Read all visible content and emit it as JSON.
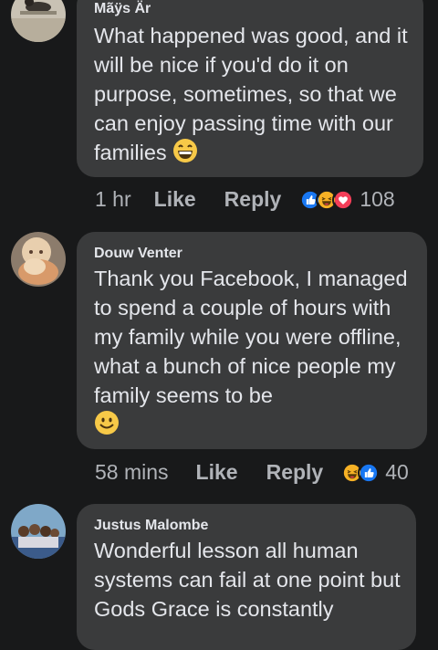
{
  "comments": [
    {
      "author": "Mãÿs Är",
      "text": "What happened was good, and it will be nice if you'd do it on purpose, sometimes, so that we can enjoy passing time with our families",
      "trailing_emoji": "grinning-face-emoji",
      "time": "1 hr",
      "like_label": "Like",
      "reply_label": "Reply",
      "reactions": [
        "like-reaction-icon",
        "haha-reaction-icon",
        "love-reaction-icon"
      ],
      "reaction_count": "108"
    },
    {
      "author": "Douw Venter",
      "text": "Thank you Facebook, I managed to spend a couple of hours with my family while you were offline, what a bunch of nice people my family seems to be",
      "trailing_emoji": "smiling-face-emoji",
      "time": "58 mins",
      "like_label": "Like",
      "reply_label": "Reply",
      "reactions": [
        "haha-reaction-icon",
        "like-reaction-icon"
      ],
      "reaction_count": "40"
    },
    {
      "author": "Justus Malombe",
      "text": "Wonderful lesson all human systems can fail at one point but Gods Grace is constantly"
    }
  ],
  "colors": {
    "background": "#18191a",
    "bubble": "#3a3b3c",
    "text": "#e4e6eb",
    "secondary_text": "#b0b3b8",
    "like_blue": "#1877f2",
    "love_red": "#f33e58",
    "haha_yellow": "#f7b125"
  }
}
